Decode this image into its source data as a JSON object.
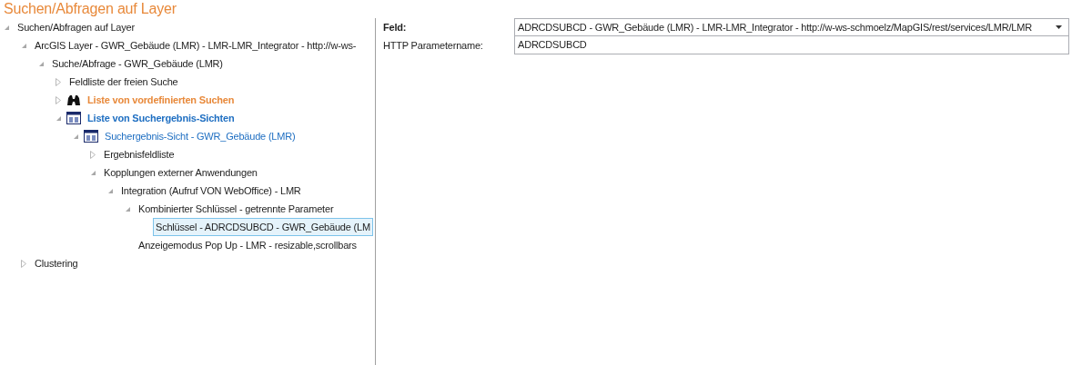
{
  "title": "Suchen/Abfragen auf Layer",
  "tree": [
    {
      "label": "Suchen/Abfragen auf Layer",
      "expanded": true,
      "selected": false,
      "children": [
        {
          "label": "ArcGIS Layer - GWR_Gebäude (LMR) - LMR-LMR_Integrator - http://w-ws-",
          "expanded": true,
          "selected": false,
          "children": [
            {
              "label": "Suche/Abfrage - GWR_Gebäude (LMR)",
              "expanded": true,
              "selected": false,
              "children": [
                {
                  "label": "Feldliste der freien Suche",
                  "expanded": false,
                  "selected": false
                },
                {
                  "label": "Liste von vordefinierten Suchen",
                  "expanded": false,
                  "selected": false,
                  "kind": "searches"
                },
                {
                  "label": "Liste von Suchergebnis-Sichten",
                  "expanded": true,
                  "selected": false,
                  "kind": "views",
                  "children": [
                    {
                      "label": "Suchergebnis-Sicht - GWR_Gebäude (LMR)",
                      "expanded": true,
                      "selected": false,
                      "kind": "view",
                      "children": [
                        {
                          "label": "Ergebnisfeldliste",
                          "expanded": false,
                          "selected": false
                        },
                        {
                          "label": "Kopplungen externer Anwendungen",
                          "expanded": true,
                          "selected": false,
                          "children": [
                            {
                              "label": "Integration (Aufruf VON WebOffice) - LMR",
                              "expanded": true,
                              "selected": false,
                              "children": [
                                {
                                  "label": "Kombinierter Schlüssel - getrennte Parameter",
                                  "expanded": true,
                                  "selected": false,
                                  "children": [
                                    {
                                      "label": "Schlüssel - ADRCDSUBCD - GWR_Gebäude (LM",
                                      "selected": true
                                    }
                                  ]
                                },
                                {
                                  "label": "Anzeigemodus Pop Up - LMR - resizable,scrollbars",
                                  "selected": false
                                }
                              ]
                            }
                          ]
                        }
                      ]
                    }
                  ]
                }
              ]
            }
          ]
        },
        {
          "label": "Clustering",
          "expanded": false,
          "selected": false
        }
      ]
    }
  ],
  "properties": [
    {
      "label": "Feld:",
      "value": "ADRCDSUBCD - GWR_Gebäude (LMR) - LMR-LMR_Integrator - http://w-ws-schmoelz/MapGIS/rest/services/LMR/LMR",
      "kind": "dropdown",
      "bold": true
    },
    {
      "label": "HTTP Parametername:",
      "value": "ADRCDSUBCD",
      "kind": "text",
      "bold": false
    }
  ]
}
